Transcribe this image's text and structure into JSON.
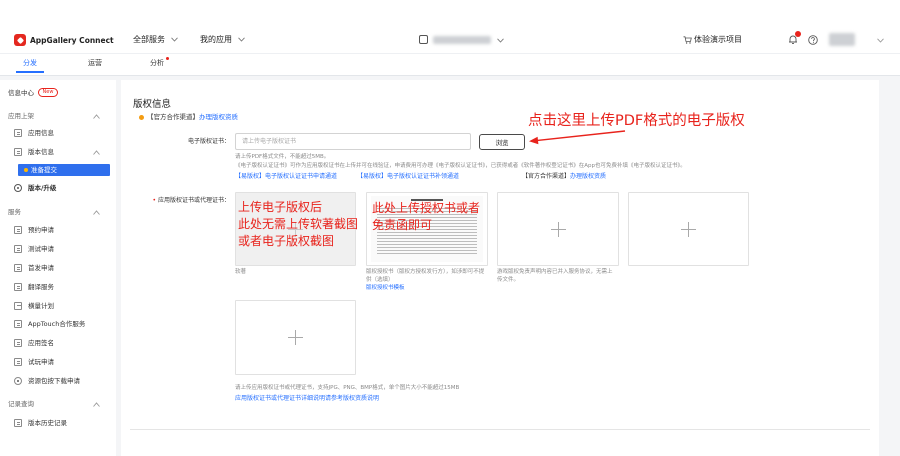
{
  "header": {
    "logo_text": "AppGallery Connect",
    "all_services": "全部服务",
    "my_apps": "我的应用",
    "demo_project": "体验演示项目",
    "icons": [
      "appgallery-logo-icon",
      "chevron-down-icon",
      "project-icon",
      "cart-icon",
      "bell-icon",
      "help-icon"
    ]
  },
  "tabs": [
    {
      "label": "分发",
      "active": true
    },
    {
      "label": "运营",
      "active": false
    },
    {
      "label": "分析",
      "active": false,
      "has_dot": true
    }
  ],
  "sidebar": {
    "info_center": "信息中心",
    "new_badge": "New",
    "app_listing": {
      "label": "应用上架",
      "expanded": true
    },
    "app_info": "应用信息",
    "version_info": "版本信息",
    "prepare_submit": "准备提交",
    "version_upgrade": "版本/升级",
    "services": {
      "label": "服务",
      "items": [
        "预约申请",
        "测试申请",
        "首发申请",
        "翻译服务",
        "横量计划",
        "AppTouch合作服务",
        "应用签名",
        "试玩申请",
        "资源包按下载申请"
      ]
    },
    "records": {
      "label": "记录查询",
      "items": [
        "版本历史记录"
      ]
    }
  },
  "main": {
    "section_title": "版权信息",
    "official_channel": {
      "prefix": "【官方合作渠道】",
      "link": "办理版权资质"
    },
    "ecert": {
      "label": "电子版权证书：",
      "placeholder": "请上传电子版权证书",
      "browse": "浏览",
      "hint": "请上传PDF格式文件，不能超过5MB。",
      "desc": "《电子版权认证证书》可作为应用版权证书在上传并可在线验证，申请费用可办理《电子版权认证证书》，已获得或者《软件著作权登记证书》在App也可免费补填《电子版权认证证书》。",
      "links": [
        "【易版权】电子版权认证证书申请通道",
        "【易版权】电子版权认证证书补领通道"
      ],
      "official_prefix": "【官方合作渠道】",
      "official_link": "办理版权资质"
    },
    "cert": {
      "label": "应用版权证书或代理证书：",
      "captions": [
        "软著",
        "版权授权书（版权方授权发行方），如涉即可不提供（选填）",
        "游戏版权免责声明内容已并入服务协议，无需上传文件。"
      ],
      "template_link": "版权授权书模板",
      "hint": "请上传应用版权证书或代理证书，支持JPG、PNG、BMP格式，单个图片大小不能超过15MB",
      "help_link": "应用版权证书或代理证书详细说明请参考版权资质说明"
    }
  },
  "annotations": {
    "upload_pdf_note": "点击这里上传PDF格式的电子版权",
    "softcopy_note": [
      "上传电子版权后",
      "此处无需上传软著截图",
      "或者电子版权截图"
    ],
    "authorization_note": [
      "此处上传授权书或者",
      "免责函即可"
    ]
  },
  "colors": {
    "accent": "#256fff",
    "annotation_red": "#e8231c",
    "orange_dot": "#f39c12",
    "selected_bg": "#2f6fed",
    "logo_red": "#e4281f"
  }
}
